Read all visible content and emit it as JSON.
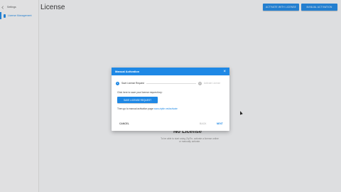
{
  "sidebar": {
    "back_label": "Settings",
    "active_label": "License Management"
  },
  "header": {
    "title": "License",
    "activate_online_label": "ACTIVATE WITH LICENSE",
    "manual_activation_label": "MANUAL ACTIVATION"
  },
  "main": {
    "no_license_title": "No License",
    "no_license_text_1": "To be able to start using ZipTie, activate a license online",
    "no_license_text_2": "or manually activate."
  },
  "dialog": {
    "title": "Manual Activation",
    "step1_number": "1",
    "step1_label": "Save License Request",
    "step2_number": "2",
    "step2_label": "Activate License",
    "instruction": "Click here to save your license request key:",
    "save_button_label": "SAVE LICENSE REQUEST",
    "then_text": "Then go to manual activation page",
    "then_link": "www.ziptie.net/activate",
    "cancel_label": "CANCEL",
    "back_label": "BACK",
    "next_label": "NEXT"
  },
  "colors": {
    "accent": "#1e88e5"
  }
}
